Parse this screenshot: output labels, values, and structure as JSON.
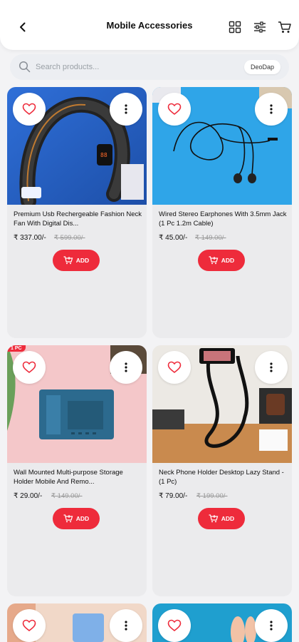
{
  "header": {
    "title": "Mobile Accessories",
    "back_icon": "chevron-left-icon",
    "grid_icon": "grid-view-icon",
    "filter_icon": "filter-sliders-icon",
    "cart_icon": "cart-icon"
  },
  "search": {
    "placeholder": "Search products...",
    "brand_chip": "DeoDap"
  },
  "colors": {
    "accent": "#ee2b3b",
    "card_bg": "#ebebed",
    "page_bg": "#f3f3f5"
  },
  "products": [
    {
      "name": "Premium Usb Rechergeable Fashion Neck Fan With Digital Dis...",
      "price": "₹ 337.00/-",
      "mrp": "₹ 599.00/-",
      "add_label": "ADD"
    },
    {
      "name": "Wired Stereo Earphones With 3.5mm Jack (1 Pc  1.2m Cable)",
      "price": "₹ 45.00/-",
      "mrp": "₹ 149.00/-",
      "add_label": "ADD"
    },
    {
      "name": "Wall Mounted Multi-purpose Storage Holder  Mobile And Remo...",
      "price": "₹ 29.00/-",
      "mrp": "₹ 149.00/-",
      "add_label": "ADD",
      "tag": "1 PC"
    },
    {
      "name": "Neck Phone Holder  Desktop Lazy Stand - (1 Pc)",
      "price": "₹ 79.00/-",
      "mrp": "₹ 199.00/-",
      "add_label": "ADD"
    }
  ]
}
